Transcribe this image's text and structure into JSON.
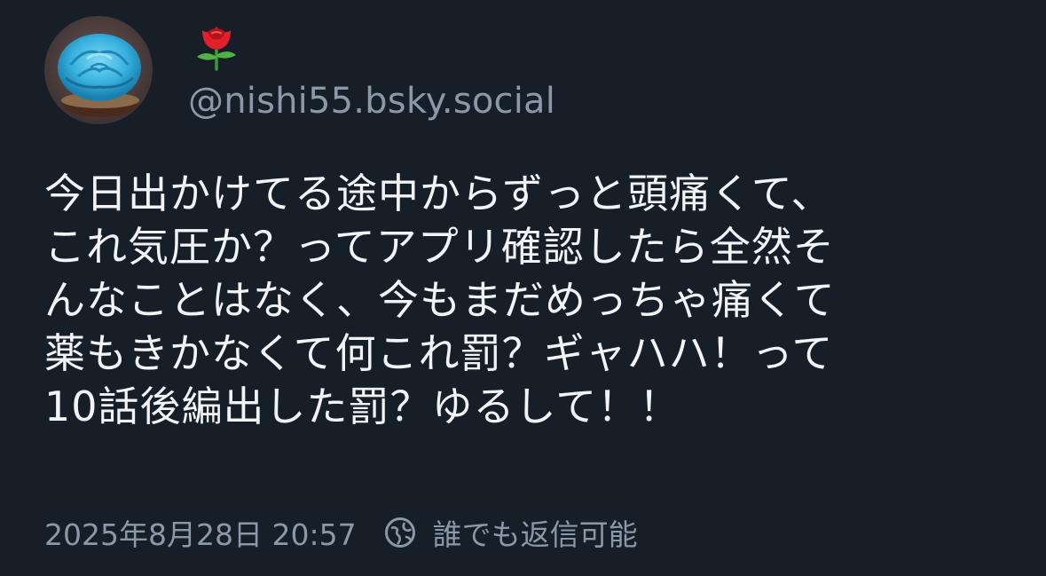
{
  "post": {
    "display_name_emoji": "rose-emoji",
    "handle": "@nishi55.bsky.social",
    "text_lines": [
      "今日出かけてる途中からずっと頭痛くて、",
      "これ気圧か？ってアプリ確認したら全然そ",
      "んなことはなく、今もまだめっちゃ痛くて",
      "薬もきかなくて何これ罰？ギャハハ！って",
      "10話後編出した罰？ゆるして！！"
    ],
    "timestamp": "2025年8月28日 20:57",
    "reply_setting": "誰でも返信可能",
    "reply_icon": "globe-icon"
  },
  "colors": {
    "background": "#161e27",
    "text": "#f1f3f5",
    "muted": "#8b98a8"
  }
}
